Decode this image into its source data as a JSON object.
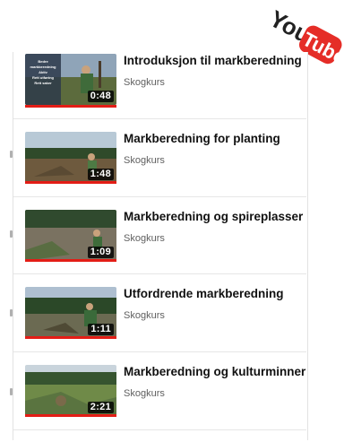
{
  "logo": {
    "brand": "YouTube",
    "you": "You",
    "tube": "Tube",
    "color": "#e52d27"
  },
  "channel_name": "Skogkurs",
  "videos": [
    {
      "title": "Introduksjon til markberedning",
      "channel": "Skogkurs",
      "duration": "0:48",
      "thumb_text": [
        "Bedre markberedning",
        "Aktiv",
        "Rett utføring",
        "Rett saker"
      ]
    },
    {
      "title": "Markberedning for planting",
      "channel": "Skogkurs",
      "duration": "1:48"
    },
    {
      "title": "Markberedning og spireplasser",
      "channel": "Skogkurs",
      "duration": "1:09"
    },
    {
      "title": "Utfordrende markberedning",
      "channel": "Skogkurs",
      "duration": "1:11"
    },
    {
      "title": "Markberedning og kulturminner",
      "channel": "Skogkurs",
      "duration": "2:21"
    }
  ],
  "colors": {
    "progress": "#e31d16",
    "title": "#111111",
    "channel": "#606060"
  }
}
